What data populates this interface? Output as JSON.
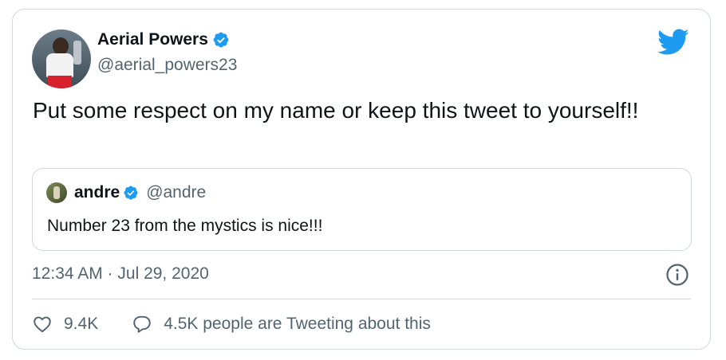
{
  "author": {
    "name": "Aerial Powers",
    "handle": "@aerial_powers23",
    "verified": true
  },
  "tweet": {
    "text": "Put some respect on my name or keep this tweet to yourself!!",
    "timestamp": "12:34 AM · Jul 29, 2020"
  },
  "quoted_tweet": {
    "name": "andre",
    "handle": "@andre",
    "verified": true,
    "text": "Number 23 from the mystics is nice!!!"
  },
  "actions": {
    "likes": "9.4K",
    "retweet_activity": "4.5K people are Tweeting about this"
  },
  "icons": {
    "brand": "twitter-bird-icon",
    "verified": "verified-badge-icon",
    "info": "info-icon",
    "like": "heart-icon",
    "reply": "speech-bubble-icon"
  },
  "colors": {
    "brand": "#1d9bf0",
    "text": "#0f1419",
    "secondary": "#536471",
    "border": "#cfd9de"
  }
}
